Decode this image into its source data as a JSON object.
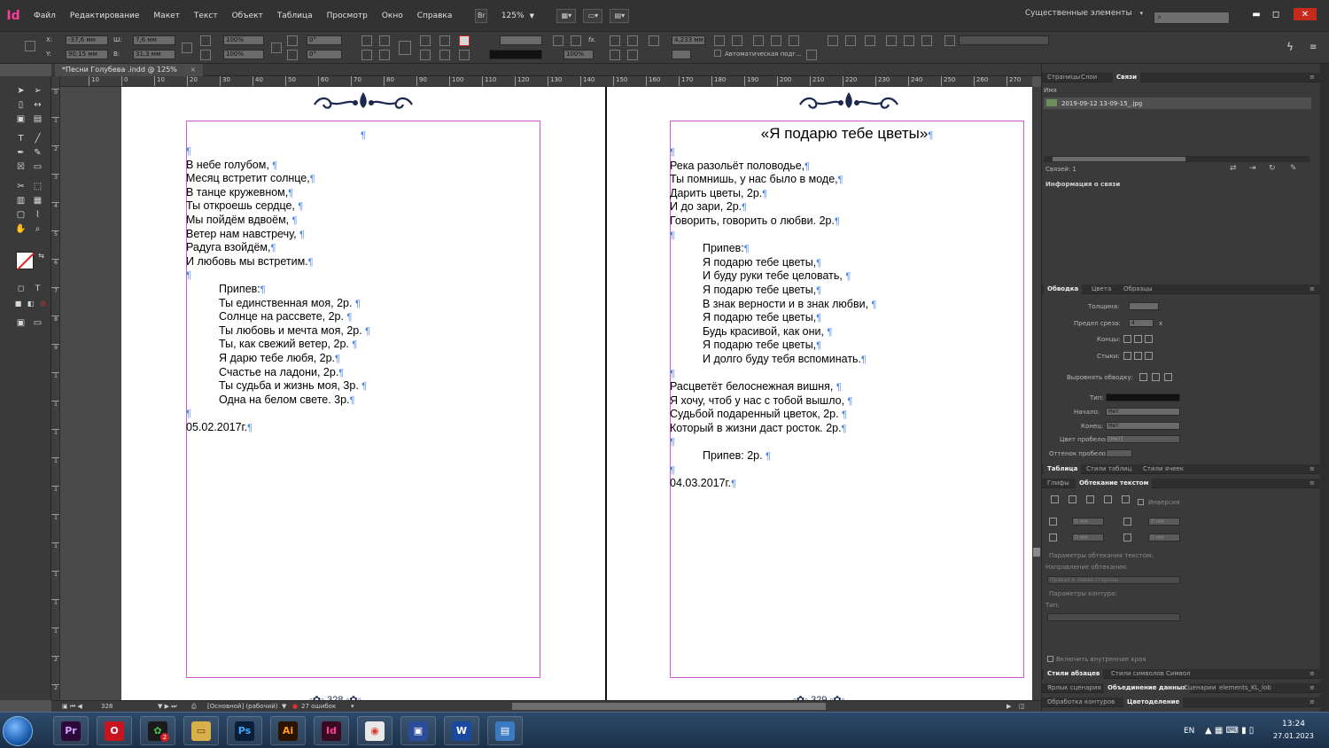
{
  "app": {
    "logo": "Id",
    "menu": [
      "Файл",
      "Редактирование",
      "Макет",
      "Текст",
      "Объект",
      "Таблица",
      "Просмотр",
      "Окно",
      "Справка"
    ],
    "bridge_label": "Br",
    "zoom": "125%",
    "workspace": "Существенные элементы",
    "search_placeholder": ""
  },
  "control_panel": {
    "x_label": "X:",
    "x_value": "-37,6 мм",
    "y_label": "Y:",
    "y_value": "90,15 мм",
    "w_label": "Ш:",
    "w_value": "7,6 мм",
    "h_label": "В:",
    "h_value": "31,3 мм",
    "scale_x": "100%",
    "scale_y": "100%",
    "rotate": "0°",
    "shear": "0°",
    "stroke_weight": "4,233 мм",
    "opacity": "100%",
    "auto_fit": "Автоматическая подг..."
  },
  "document": {
    "tab_title": "*Песни Голубева .indd @ 125%",
    "tab_close": "×",
    "ruler_h": [
      "10",
      "0",
      "10",
      "20",
      "30",
      "40",
      "50",
      "60",
      "70",
      "80",
      "90",
      "100",
      "110",
      "120",
      "130",
      "140",
      "150",
      "160",
      "170",
      "180",
      "190",
      "200",
      "210",
      "220",
      "230",
      "240",
      "250",
      "260",
      "270"
    ],
    "ruler_v": [
      "0",
      "1",
      "2",
      "3",
      "4",
      "5",
      "6",
      "7",
      "8",
      "9",
      "1",
      "1",
      "1",
      "1",
      "1",
      "1",
      "1",
      "1",
      "1",
      "1",
      "2",
      "2"
    ],
    "pilcrow": "¶",
    "left_page": {
      "number": "328",
      "lines": [
        {
          "t": "",
          "indent": false
        },
        {
          "t": "В небе голубом, ",
          "indent": false
        },
        {
          "t": "Месяц встретит солнце,",
          "indent": false
        },
        {
          "t": "В танце кружевном,",
          "indent": false
        },
        {
          "t": "Ты откроешь сердце, ",
          "indent": false
        },
        {
          "t": "Мы пойдём вдвоём, ",
          "indent": false
        },
        {
          "t": "Ветер нам навстречу, ",
          "indent": false
        },
        {
          "t": "Радуга взойдём,",
          "indent": false
        },
        {
          "t": "И любовь мы встретим.",
          "indent": false
        },
        {
          "t": "",
          "indent": false
        },
        {
          "t": "Припев:",
          "indent": true
        },
        {
          "t": "Ты единственная моя, 2р. ",
          "indent": true
        },
        {
          "t": "Солнце на рассвете, 2р. ",
          "indent": true
        },
        {
          "t": "Ты любовь и мечта моя, 2р. ",
          "indent": true
        },
        {
          "t": "Ты, как свежий ветер, 2р. ",
          "indent": true
        },
        {
          "t": "Я дарю тебе любя, 2р.",
          "indent": true
        },
        {
          "t": "Счастье на ладони, 2р.",
          "indent": true
        },
        {
          "t": "Ты судьба и жизнь моя, 3р. ",
          "indent": true
        },
        {
          "t": "Одна на белом свете. 3р.",
          "indent": true
        },
        {
          "t": "",
          "indent": false
        },
        {
          "t": "05.02.2017г.",
          "indent": false
        }
      ]
    },
    "right_page": {
      "number": "329",
      "title": "«Я подарю тебе цветы»",
      "lines": [
        {
          "t": "",
          "indent": false
        },
        {
          "t": "Река разольёт половодье,",
          "indent": false
        },
        {
          "t": "Ты помнишь, у нас было в моде,",
          "indent": false
        },
        {
          "t": "Дарить цветы, 2р.",
          "indent": false
        },
        {
          "t": "И до зари, 2р.",
          "indent": false
        },
        {
          "t": "Говорить, говорить о любви. 2р.",
          "indent": false
        },
        {
          "t": "",
          "indent": false
        },
        {
          "t": "Припев:",
          "indent": true
        },
        {
          "t": "Я подарю тебе цветы,",
          "indent": true
        },
        {
          "t": "И буду руки тебе целовать, ",
          "indent": true
        },
        {
          "t": "Я подарю тебе цветы,",
          "indent": true
        },
        {
          "t": "В знак верности и в знак любви, ",
          "indent": true
        },
        {
          "t": "Я подарю тебе цветы,",
          "indent": true
        },
        {
          "t": "Будь красивой, как они, ",
          "indent": true
        },
        {
          "t": "Я подарю тебе цветы,",
          "indent": true
        },
        {
          "t": "И долго буду тебя вспоминать.",
          "indent": true
        },
        {
          "t": "",
          "indent": false
        },
        {
          "t": "Расцветёт белоснежная вишня, ",
          "indent": false
        },
        {
          "t": "Я хочу, чтоб у нас с тобой вышло, ",
          "indent": false
        },
        {
          "t": "Судьбой подаренный цветок, 2р. ",
          "indent": false
        },
        {
          "t": "Который в жизни даст росток. 2р.",
          "indent": false
        },
        {
          "t": "",
          "indent": false
        },
        {
          "t": "Припев: 2р. ",
          "indent": true
        },
        {
          "t": "",
          "indent": false
        },
        {
          "t": "04.03.2017г.",
          "indent": false
        }
      ]
    }
  },
  "status": {
    "page": "328",
    "style": "[Основной] (рабочий)",
    "errors": "27 ошибок"
  },
  "panels": {
    "links_tabs": [
      "Страницы",
      "Слои",
      "Связи"
    ],
    "links_col": "Имя",
    "link_file": "2019-09-12 13-09-15_.jpg",
    "links_count": "Связей: 1",
    "link_info": "Информация о связи",
    "stroke_tabs": [
      "Обводка",
      "Цвета",
      "Образцы"
    ],
    "stroke_weight_label": "Толщина:",
    "miter_label": "Предел среза:",
    "miter_value": "4",
    "miter_unit": "x",
    "caps_label": "Концы:",
    "joins_label": "Стыки:",
    "align_label": "Выровнять обводку:",
    "type_label": "Тип:",
    "start_label": "Начало:",
    "start_value": "Нет",
    "end_label": "Конец:",
    "end_value": "Нет",
    "gap_color_label": "Цвет пробелов:",
    "gap_color_value": "[Нет]",
    "gap_tint_label": "Оттенок пробелов:",
    "table_tabs": [
      "Таблица",
      "Стили таблиц",
      "Стили ячеек"
    ],
    "wrap_tabs": [
      "Глифы",
      "Обтекание текстом"
    ],
    "invert_label": "Инверсия",
    "wrap_v1": "0 мм",
    "wrap_v2": "0 мм",
    "wrap_v3": "0 мм",
    "wrap_v4": "0 мм",
    "wrap_params": "Параметры обтекания текстом:",
    "wrap_dir": "Направление обтекания:",
    "wrap_dir_value": "Правая и левая стороны",
    "contour_params": "Параметры контура:",
    "contour_type": "Тип:",
    "inner_edges": "Включить внутренние края",
    "bottom_tabs1": [
      "Стили абзацев",
      "Стили символов",
      "Символ"
    ],
    "bottom_tabs2": [
      "Ярлык сценария",
      "Объединение данных",
      "Сценарии",
      "elements_KL_lob"
    ],
    "bottom_tabs3": [
      "Обработка контуров",
      "Цветоделение"
    ]
  },
  "taskbar": {
    "apps": [
      {
        "label": "Pr",
        "color": "#2a0a3a",
        "fg": "#d6a0ff"
      },
      {
        "label": "O",
        "color": "#c8141e",
        "fg": "#ffffff"
      },
      {
        "label": "✿",
        "color": "#1a1a1a",
        "fg": "#4ec04e"
      },
      {
        "label": "▭",
        "color": "#d8b04a",
        "fg": "#5a3a00"
      },
      {
        "label": "Ps",
        "color": "#0a1e3a",
        "fg": "#3ea8ff"
      },
      {
        "label": "Ai",
        "color": "#2a1400",
        "fg": "#ff9a1a"
      },
      {
        "label": "Id",
        "color": "#3a0a22",
        "fg": "#ff3d9a"
      },
      {
        "label": "◉",
        "color": "#e8e8e8",
        "fg": "#d83a2a"
      },
      {
        "label": "▣",
        "color": "#2a4c9a",
        "fg": "#ffffff"
      },
      {
        "label": "W",
        "color": "#1a4aa0",
        "fg": "#ffffff"
      },
      {
        "label": "▤",
        "color": "#3a7ac0",
        "fg": "#ffffff"
      }
    ],
    "badge": "2",
    "lang": "EN",
    "time": "13:24",
    "date": "27.01.2023"
  }
}
